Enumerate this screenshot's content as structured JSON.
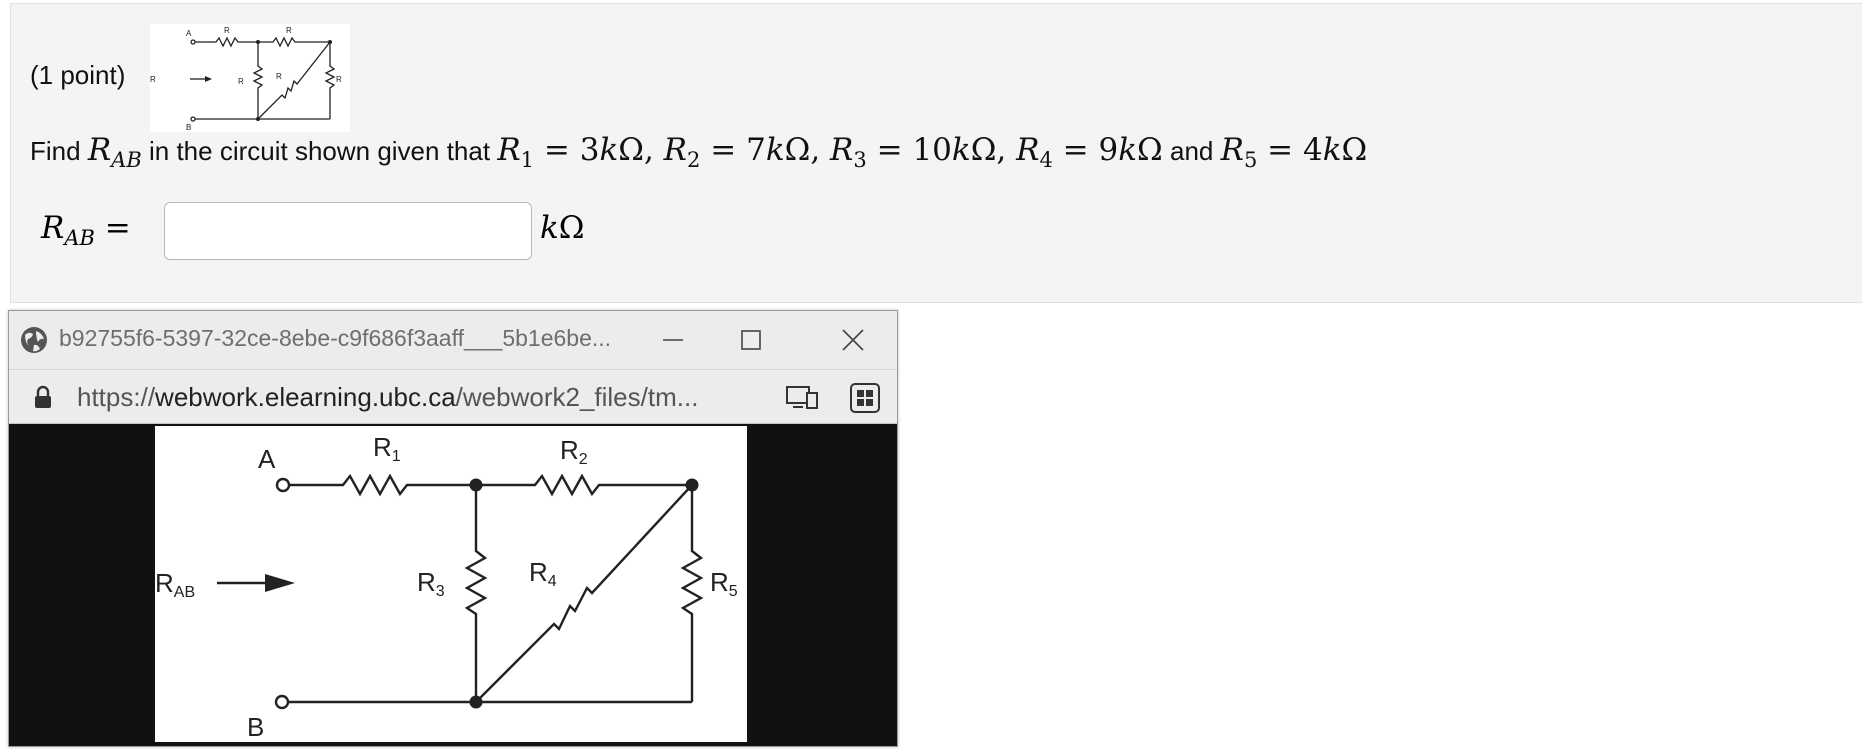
{
  "problem": {
    "points_label": "(1 point)",
    "find_word": "Find",
    "shown_text": "in the circuit shown given that",
    "and_word": "and",
    "answer_placeholder": "",
    "answer_value": "",
    "values": {
      "r1": "3",
      "r2": "7",
      "r3": "10",
      "r4": "9",
      "r5": "4"
    },
    "unit_prefix": "k",
    "unit_symbol": "Ω"
  },
  "circuit": {
    "node_a": "A",
    "node_b": "B",
    "rab_label": "R",
    "rab_sub": "AB",
    "r1_label": "R",
    "r1_sub": "1",
    "r2_label": "R",
    "r2_sub": "2",
    "r3_label": "R",
    "r3_sub": "3",
    "r4_label": "R",
    "r4_sub": "4",
    "r5_label": "R",
    "r5_sub": "5"
  },
  "popup": {
    "title": "b92755f6-5397-32ce-8ebe-c9f686f3aaff___5b1e6be...",
    "url_proto": "https://",
    "url_host": "webwork.elearning.ubc.ca",
    "url_path": "/webwork2_files/tm...",
    "icons": [
      "globe-icon",
      "minimize-icon",
      "maximize-icon",
      "close-icon",
      "lock-icon",
      "device-icon",
      "extensions-icon"
    ]
  },
  "colors": {
    "panel_bg": "#f4f4f4",
    "popup_chrome": "#ececec",
    "popup_backdrop": "#111111"
  }
}
